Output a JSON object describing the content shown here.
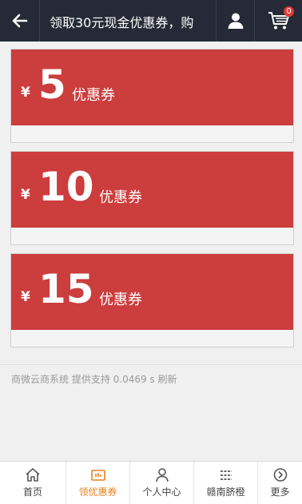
{
  "header": {
    "title": "领取30元现金优惠券，购",
    "cart_count": "0"
  },
  "coupons": [
    {
      "currency": "¥",
      "amount": "5",
      "label": "优惠券"
    },
    {
      "currency": "¥",
      "amount": "10",
      "label": "优惠券"
    },
    {
      "currency": "¥",
      "amount": "15",
      "label": "优惠券"
    }
  ],
  "footer_text": "商微云商系统 提供支持 0.0469 s 刷新",
  "tabs": [
    {
      "label": "首页",
      "icon": "home-icon"
    },
    {
      "label": "领优惠券",
      "icon": "coupon-icon",
      "active": true
    },
    {
      "label": "个人中心",
      "icon": "user-icon"
    },
    {
      "label": "赣南脐橙",
      "icon": "list-icon"
    },
    {
      "label": "更多",
      "icon": "more-icon"
    }
  ],
  "colors": {
    "header_bg": "#252a36",
    "coupon_red": "#cc3d3d",
    "active_tab": "#e8801f"
  }
}
